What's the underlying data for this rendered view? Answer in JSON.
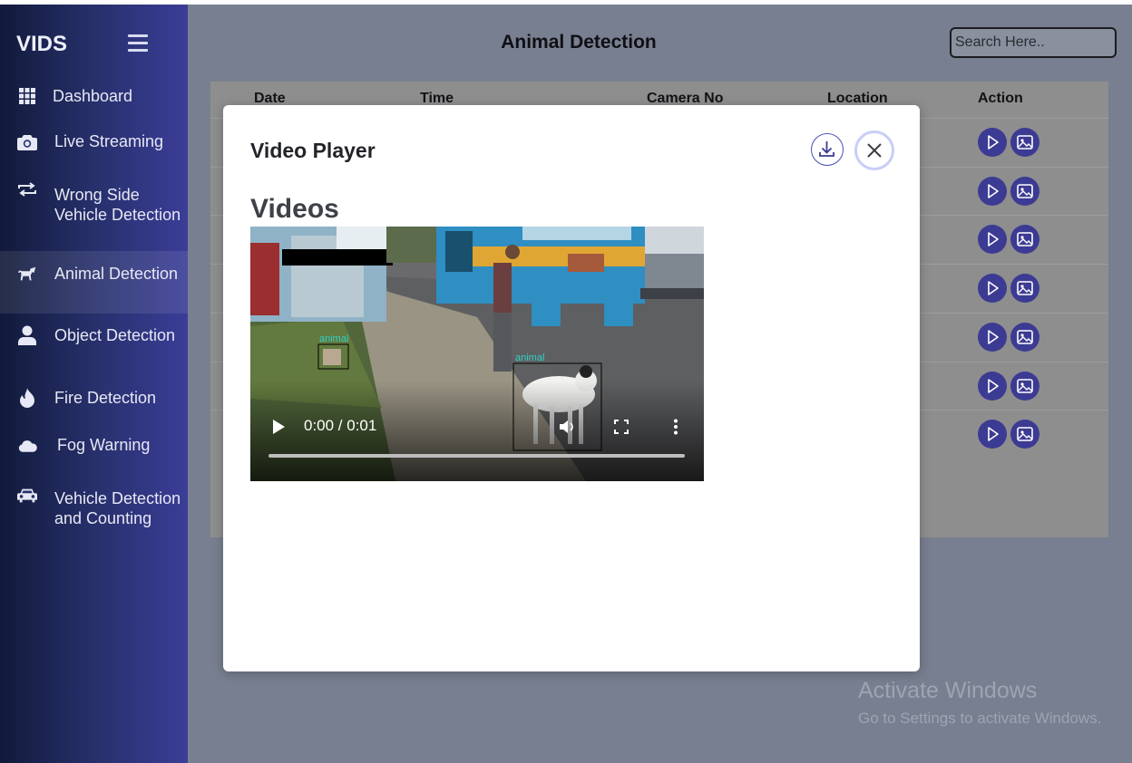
{
  "sidebar": {
    "brand": "VIDS",
    "items": [
      {
        "label": "Dashboard",
        "icon": "grid-icon"
      },
      {
        "label": "Live Streaming",
        "icon": "camera-icon"
      },
      {
        "label": "Wrong Side Vehicle Detection",
        "icon": "swap-arrows-icon"
      },
      {
        "label": "Animal Detection",
        "icon": "horse-icon",
        "active": true
      },
      {
        "label": "Object Detection",
        "icon": "person-icon"
      },
      {
        "label": "Fire Detection",
        "icon": "flame-icon"
      },
      {
        "label": "Fog Warning",
        "icon": "cloud-icon"
      },
      {
        "label": "Vehicle Detection and Counting",
        "icon": "car-icon"
      }
    ]
  },
  "header": {
    "title": "Animal Detection",
    "search_placeholder": "Search Here.."
  },
  "table": {
    "columns": [
      "Date",
      "Time",
      "Camera No",
      "Location",
      "Action"
    ],
    "row_count": 7
  },
  "modal": {
    "title": "Video Player",
    "section_heading": "Videos",
    "video": {
      "time_display": "0:00 / 0:01",
      "detection_labels": [
        "animal",
        "animal"
      ]
    }
  },
  "watermark": {
    "line1": "Activate Windows",
    "line2": "Go to Settings to activate Windows."
  },
  "colors": {
    "accent": "#3c3b93",
    "sidebar_start": "#111a3a",
    "sidebar_end": "#3b3d97",
    "overlay": "#787f90"
  }
}
